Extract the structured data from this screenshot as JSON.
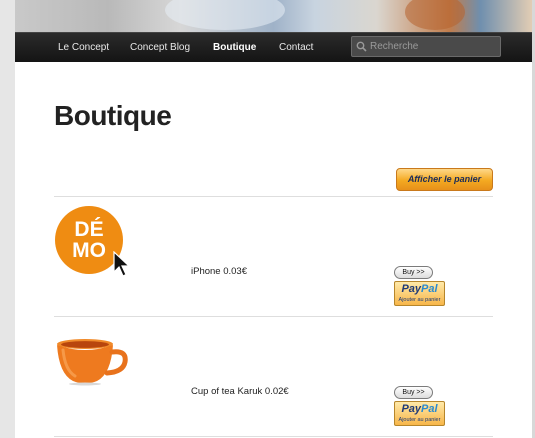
{
  "nav": {
    "items": [
      {
        "label": "Le Concept",
        "active": false
      },
      {
        "label": "Concept Blog",
        "active": false
      },
      {
        "label": "Boutique",
        "active": true
      },
      {
        "label": "Contact",
        "active": false
      }
    ],
    "search_placeholder": "Recherche"
  },
  "page": {
    "title": "Boutique",
    "cart_button_label": "Afficher le panier"
  },
  "products": [
    {
      "name": "iPhone 0.03€",
      "image": "demo-badge",
      "image_text": [
        "DÉ",
        "MO"
      ],
      "buy_label": "Buy >>",
      "paypal_logo_a": "Pay",
      "paypal_logo_b": "Pal",
      "paypal_sub": "Ajouter au panier"
    },
    {
      "name": "Cup of tea Karuk 0.02€",
      "image": "cup-icon",
      "buy_label": "Buy >>",
      "paypal_logo_a": "Pay",
      "paypal_logo_b": "Pal",
      "paypal_sub": "Ajouter au panier"
    }
  ],
  "colors": {
    "accent_orange": "#ef8c12",
    "navbar": "#1a1a1a",
    "paypal_blue": "#1e3a78"
  }
}
